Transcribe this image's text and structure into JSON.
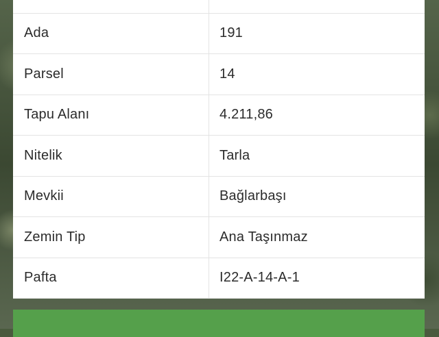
{
  "rows": [
    {
      "label": "",
      "value": ""
    },
    {
      "label": "Ada",
      "value": "191"
    },
    {
      "label": "Parsel",
      "value": "14"
    },
    {
      "label": "Tapu Alanı",
      "value": "4.211,86"
    },
    {
      "label": "Nitelik",
      "value": "Tarla"
    },
    {
      "label": "Mevkii",
      "value": "Bağlarbaşı"
    },
    {
      "label": "Zemin Tip",
      "value": "Ana Taşınmaz"
    },
    {
      "label": "Pafta",
      "value": "I22-A-14-A-1"
    }
  ],
  "colors": {
    "accent_green": "#55a04b",
    "card_bg": "#ffffff",
    "divider": "#e3e3e3"
  }
}
